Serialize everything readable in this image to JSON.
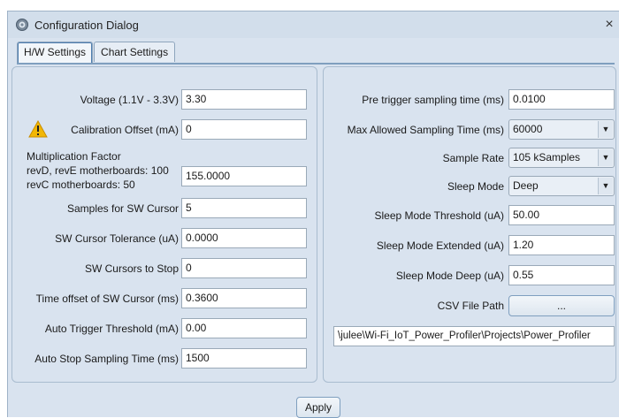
{
  "window": {
    "title": "Configuration Dialog",
    "close": "×"
  },
  "tabs": [
    {
      "label": "H/W Settings",
      "active": true
    },
    {
      "label": "Chart Settings",
      "active": false
    }
  ],
  "left": {
    "voltage": {
      "label": "Voltage (1.1V - 3.3V)",
      "value": "3.30"
    },
    "calibration": {
      "label": "Calibration Offset (mA)",
      "value": "0"
    },
    "multiplication": {
      "line1": "Multiplication Factor",
      "line2": "revD, revE motherboards: 100",
      "line3": "revC motherboards: 50",
      "value": "155.0000"
    },
    "samples_cursor": {
      "label": "Samples for SW Cursor",
      "value": "5"
    },
    "cursor_tolerance": {
      "label": "SW Cursor Tolerance (uA)",
      "value": "0.0000"
    },
    "cursors_stop": {
      "label": "SW Cursors to Stop",
      "value": "0"
    },
    "time_offset": {
      "label": "Time offset of SW Cursor (ms)",
      "value": "0.3600"
    },
    "auto_trigger": {
      "label": "Auto Trigger Threshold (mA)",
      "value": "0.00"
    },
    "auto_stop": {
      "label": "Auto Stop Sampling Time (ms)",
      "value": "1500"
    }
  },
  "right": {
    "pre_trigger": {
      "label": "Pre trigger sampling time (ms)",
      "value": "0.0100"
    },
    "max_sampling": {
      "label": "Max Allowed Sampling Time (ms)",
      "value": "60000"
    },
    "sample_rate": {
      "label": "Sample Rate",
      "value": "105 kSamples"
    },
    "sleep_mode": {
      "label": "Sleep Mode",
      "value": "Deep"
    },
    "sleep_threshold": {
      "label": "Sleep Mode Threshold (uA)",
      "value": "50.00"
    },
    "sleep_extended": {
      "label": "Sleep Mode Extended (uA)",
      "value": "1.20"
    },
    "sleep_deep": {
      "label": "Sleep Mode Deep (uA)",
      "value": "0.55"
    },
    "csv": {
      "label": "CSV File Path",
      "button": "...",
      "path": "\\julee\\Wi-Fi_IoT_Power_Profiler\\Projects\\Power_Profiler"
    }
  },
  "footer": {
    "apply": "Apply"
  },
  "icons": {
    "app": "gear-icon",
    "warning": "warning-icon"
  },
  "colors": {
    "window_bg": "#d9e3ef",
    "warning": "#f2b705",
    "tab_border": "#4f7fb0"
  }
}
